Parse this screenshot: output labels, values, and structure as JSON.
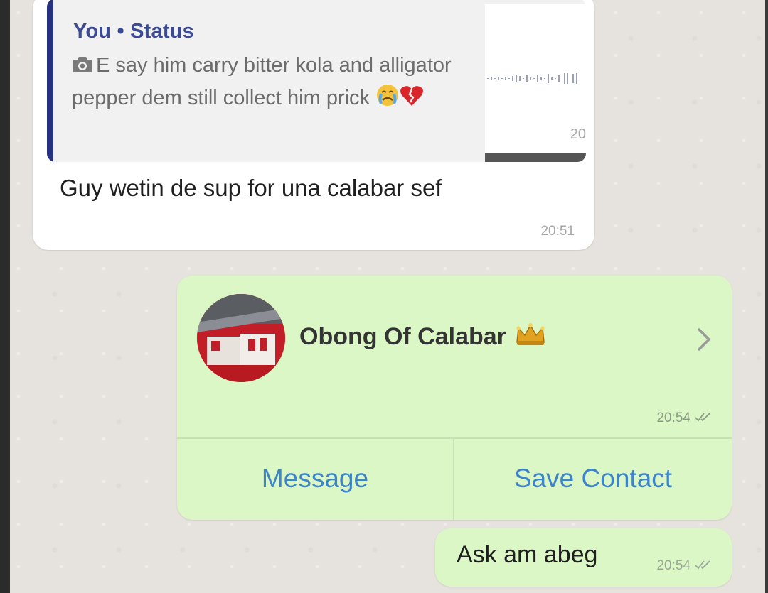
{
  "messages": {
    "incoming": {
      "quote": {
        "author": "You • Status",
        "text": "E say him carry bitter kola and alligator pepper dem still collect him prick",
        "thumb_time": "20"
      },
      "text": "Guy wetin de sup for una calabar sef",
      "time": "20:51"
    },
    "contact_card": {
      "name": "Obong Of Calabar",
      "time": "20:54",
      "actions": {
        "message": "Message",
        "save_contact": "Save Contact"
      }
    },
    "outgoing": {
      "text": "Ask am abeg",
      "time": "20:54"
    }
  },
  "icons": {
    "camera": "camera-icon",
    "crying_face": "crying-face-emoji",
    "broken_heart": "broken-heart-emoji",
    "crown": "crown-emoji",
    "chevron": "chevron-right-icon",
    "double_check": "double-check-icon"
  },
  "colors": {
    "incoming_bubble": "#ffffff",
    "outgoing_bubble": "#dcf7c6",
    "quote_bar": "#28337f",
    "quote_author": "#3a4a94",
    "link_blue": "#3d84c9",
    "chat_background": "#e6e2dd"
  }
}
